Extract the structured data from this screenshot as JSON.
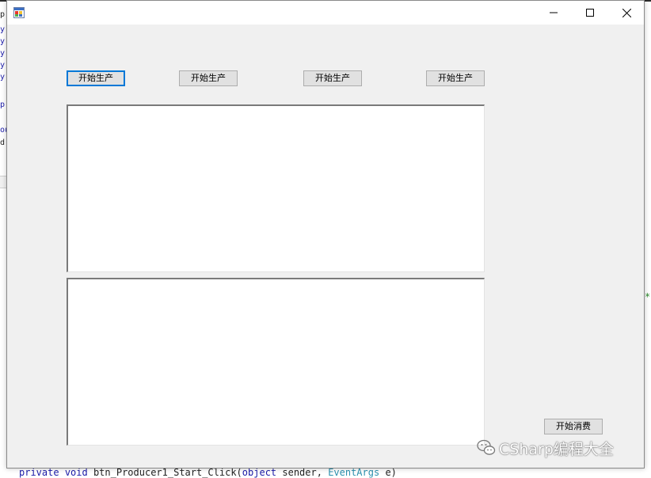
{
  "background": {
    "gutter_lines": [
      "p",
      "y",
      "y",
      "y",
      "y",
      "y",
      "",
      "p",
      "",
      "ou",
      "d"
    ],
    "right_mark": "*",
    "code_line": {
      "kw1": "private",
      "kw2": "void",
      "method": " btn_Producer1_Start_Click(",
      "kw3": "object",
      "arg1": " sender, ",
      "type": "EventArgs",
      "arg2": " e)"
    }
  },
  "window": {
    "title": "",
    "controls": {
      "minimize": "—",
      "maximize": "☐",
      "close": "✕"
    }
  },
  "form": {
    "producer_buttons": [
      {
        "label": "开始生产"
      },
      {
        "label": "开始生产"
      },
      {
        "label": "开始生产"
      },
      {
        "label": "开始生产"
      }
    ],
    "consume_button": {
      "label": "开始消费"
    },
    "textbox_top": {
      "value": ""
    },
    "textbox_bottom": {
      "value": ""
    }
  },
  "watermark": {
    "text": "CSharp编程大全",
    "icon": "wechat-icon"
  },
  "colors": {
    "focus_border": "#0078d7",
    "form_bg": "#f0f0f0",
    "button_bg": "#e1e1e1"
  }
}
